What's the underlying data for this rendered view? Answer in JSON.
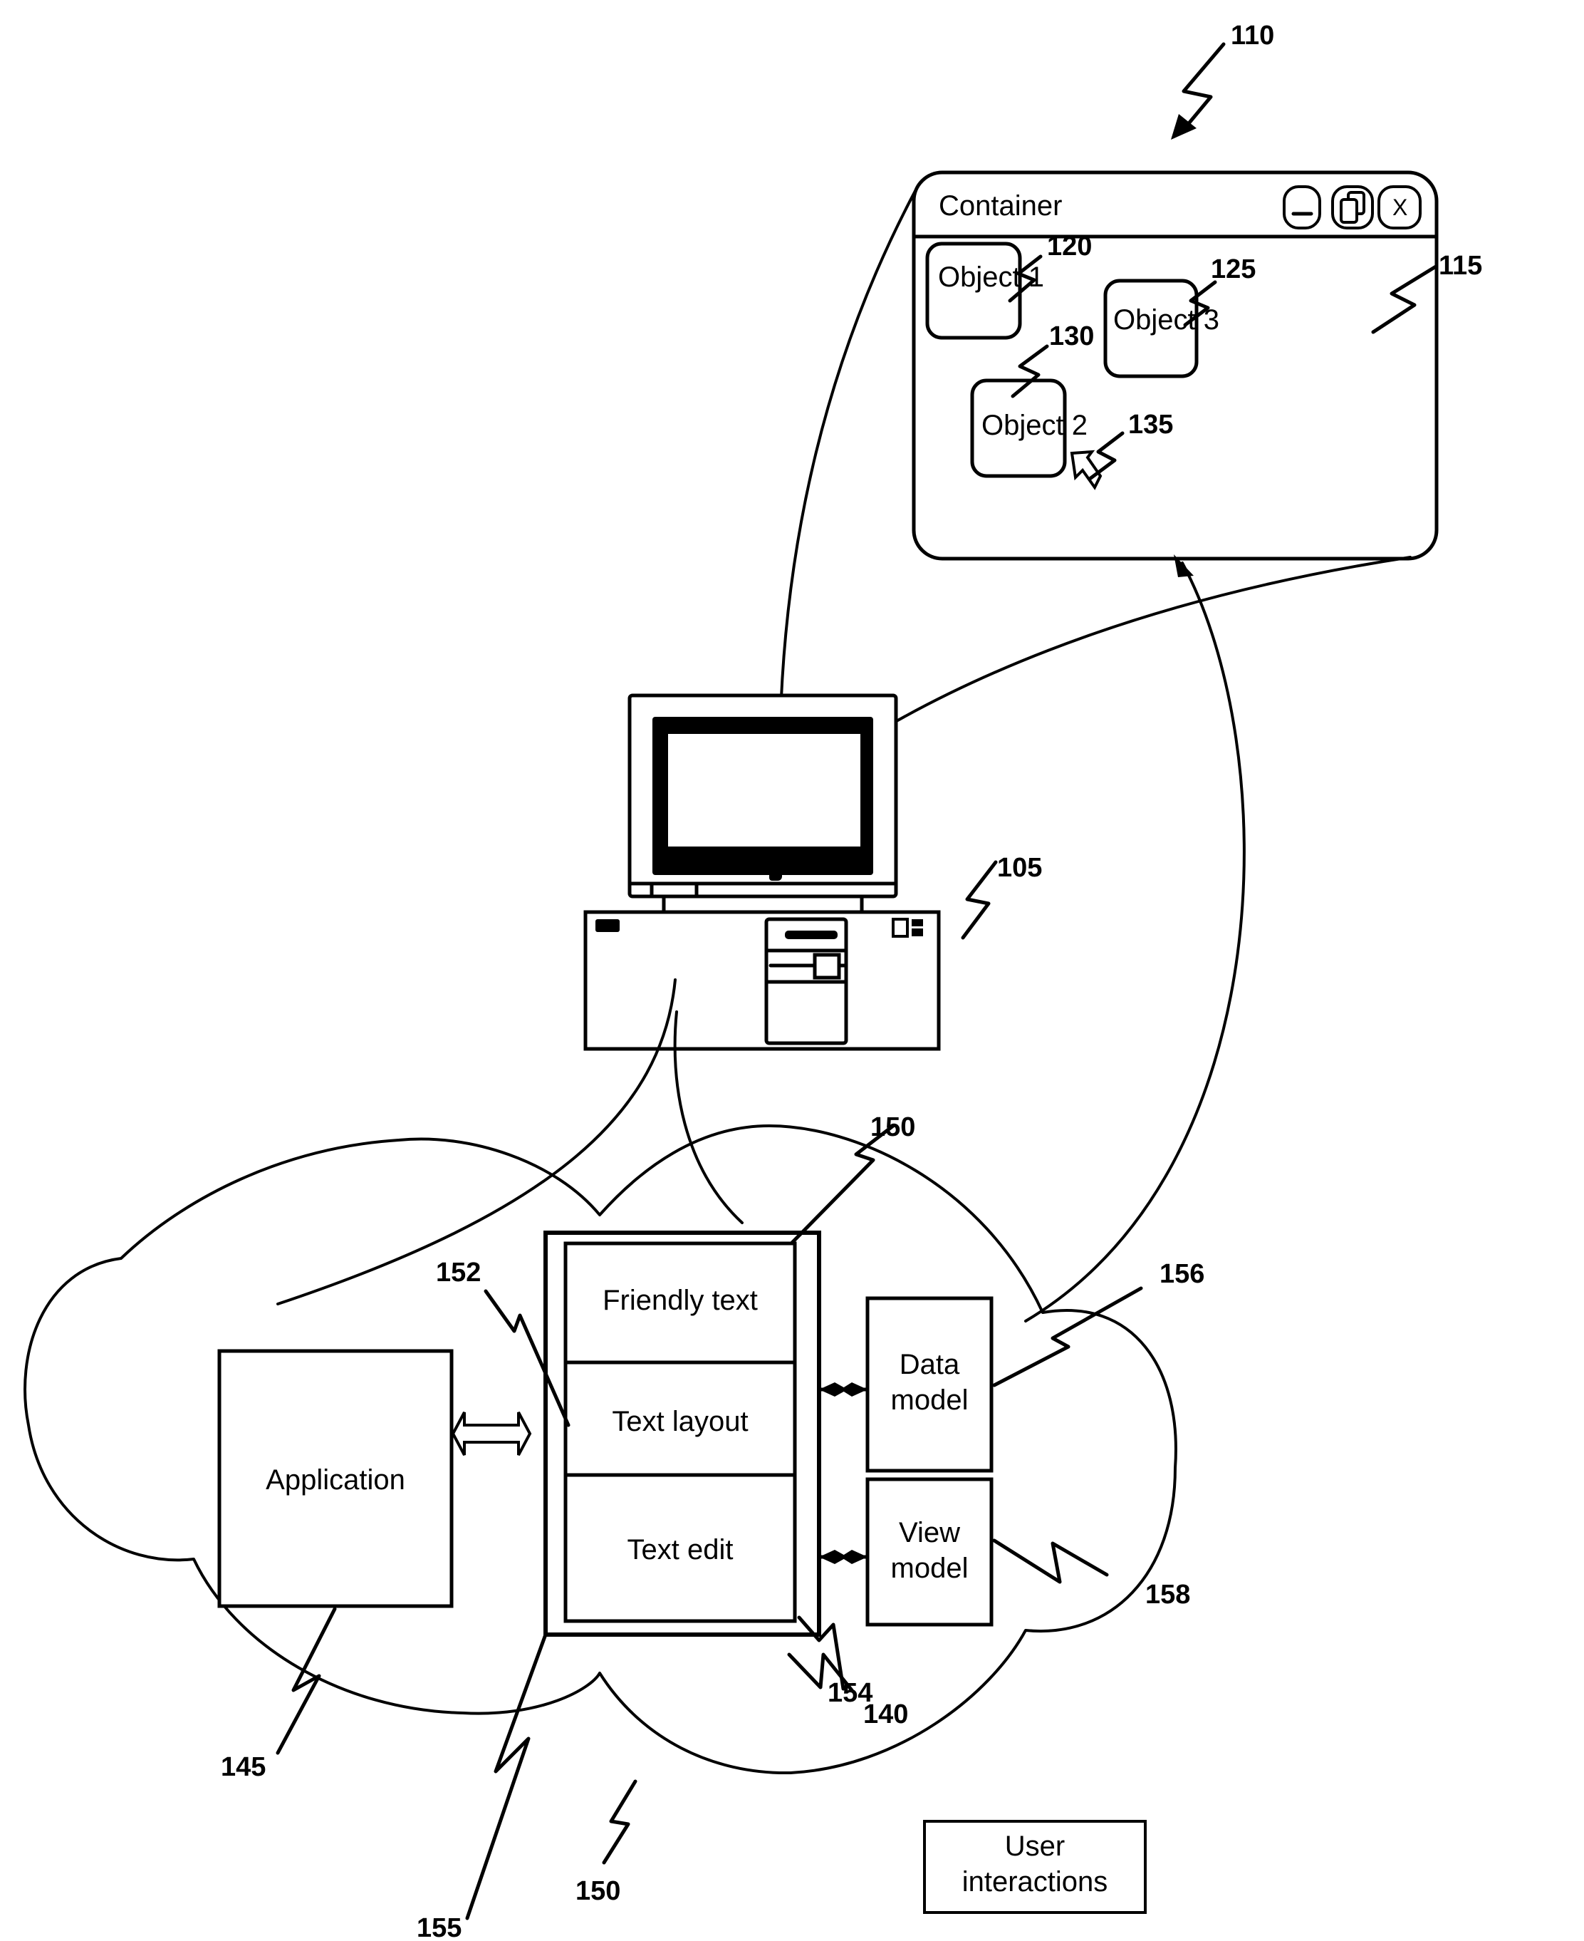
{
  "figure": {
    "container_window": {
      "title": "Container",
      "buttons": {
        "minimize": "minimize-icon",
        "restore": "restore-icon",
        "close": "X"
      },
      "objects": [
        {
          "label": "Object 1",
          "ref": "120"
        },
        {
          "label": "Object 3",
          "ref": "125"
        },
        {
          "label": "Object 2",
          "ref": "130"
        }
      ],
      "cursor_ref": "135",
      "ref": "115"
    },
    "display_ref": "110",
    "computer_ref": "105",
    "cloud": {
      "ref": "140",
      "application": {
        "label": "Application",
        "ref": "145"
      },
      "text_stack": {
        "ref": "150",
        "layers": [
          {
            "label": "Friendly text"
          },
          {
            "label": "Text layout"
          },
          {
            "label": "Text edit"
          }
        ],
        "layout_ref": "152",
        "edit_ref": "154",
        "outer_ref": "155"
      },
      "data_model": {
        "line1": "Data",
        "line2": "model",
        "ref": "156"
      },
      "view_model": {
        "line1": "View",
        "line2": "model",
        "ref": "158"
      }
    },
    "bottom_ref": "150",
    "user_interactions": {
      "line1": "User",
      "line2": "interactions"
    }
  }
}
